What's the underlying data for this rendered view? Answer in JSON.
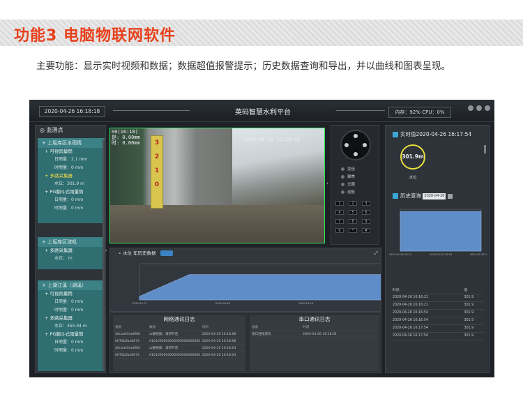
{
  "banner": {
    "title": "功能3  电脑物联网软件"
  },
  "description": "主要功能：显示实时视频和数据；数据超值报警提示；历史数据查询和导出，并以曲线和图表呈现。",
  "app": {
    "header": {
      "datetime": "2020-04-26 16:18:18",
      "title": "英码智慧水利平台",
      "status": "内存：92%  CPU：0%"
    },
    "sidebar": {
      "title": "监测点",
      "groups": [
        {
          "name": "上坂库区水雨情",
          "items": [
            {
              "label": "可视雨量筒",
              "values": [
                "日雨量：2.1 mm",
                "时雨量：0 mm"
              ]
            },
            {
              "label": "多路采集器",
              "selected": true,
              "values": [
                "水位：301.9 m"
              ]
            },
            {
              "label": "PG翻斗式雨量筒",
              "values": [
                "日雨量：0 mm",
                "时雨量：0 mm"
              ]
            }
          ]
        },
        {
          "name": "上坂库区球机",
          "items": [
            {
              "label": "多路采集器",
              "values": [
                "水位：  m"
              ]
            }
          ]
        },
        {
          "name": "上湖江溪（湖溪）",
          "items": [
            {
              "label": "可视雨量筒",
              "values": [
                "日雨量：0 mm",
                "时雨量：0 mm"
              ]
            },
            {
              "label": "多路采集器",
              "values": [
                "水位：355.04  m"
              ]
            },
            {
              "label": "PG翻斗式雨量筒",
              "values": [
                "日雨量：0 mm",
                "时雨量：0 mm"
              ]
            }
          ]
        }
      ]
    },
    "video": {
      "osd_left": "00(16:18)\n是: 0.00mm\n时: 0.00mm",
      "osd_right": "2020-04-26 16:18:18",
      "ruler": [
        "3",
        "2",
        "1",
        "0"
      ]
    },
    "ptz": {
      "buttons": [
        "变倍",
        "聚焦",
        "光圈",
        "巡航"
      ],
      "keys": [
        "1",
        "2",
        "3",
        "4",
        "5",
        "6",
        "7",
        "8",
        "9",
        "0",
        "*",
        "#"
      ]
    },
    "history_chart": {
      "title": "水位 年历史数据"
    },
    "logs": {
      "network": {
        "title": "网络通讯日志",
        "headers": [
          "设备",
          "数据",
          "时间"
        ],
        "rows": [
          [
            "d0cade5ea6f00",
            "山巅视频，请求开启",
            "2020-04-26 16:18:08"
          ],
          [
            "0070b5ba0874",
            "01010000000000000000000000000000",
            "2020-04-26 16:18:08"
          ],
          [
            "d0cade5ea6f00",
            "山巅视频，请求开启",
            "2020-04-26 16:18:03"
          ],
          [
            "0070b5ba0874",
            "01010000000000000000000000000000",
            "2020-04-26 16:18:03"
          ]
        ]
      },
      "serial": {
        "title": "串口通讯日志",
        "headers": [
          "设备",
          "",
          "时间"
        ],
        "rows": [
          [
            "接口连接成功",
            "",
            "2020-04-26 16:18:01"
          ]
        ]
      }
    },
    "right_panel": {
      "realtime_title": "实时值2020-04-26 16:17:54",
      "gauge_value": "301.9m",
      "gauge_label": "水位",
      "history_title": "历史查询",
      "history_date": "2020-04-26",
      "table_headers": [
        "时间",
        "值"
      ],
      "table_rows": [
        [
          "2020-04-26 16:16:21",
          "301.9"
        ],
        [
          "2020-04-26 16:16:21",
          "301.9"
        ],
        [
          "2020-04-26 16:16:54",
          "301.9"
        ],
        [
          "2020-04-26 16:16:54",
          "301.9"
        ],
        [
          "2020-04-26 16:17:54",
          "301.9"
        ],
        [
          "2020-04-26 16:17:54",
          "301.9"
        ]
      ]
    }
  },
  "chart_data": [
    {
      "type": "area",
      "ylim": [
        0,
        1
      ],
      "x": [
        "2020-03-27",
        "2020-04-06",
        "2020-04-16",
        "2020-04-26"
      ],
      "series": [
        {
          "values": [
            0.1,
            0.7,
            0.7,
            0.7,
            0.7,
            0.7
          ]
        }
      ]
    },
    {
      "type": "area",
      "ylim": [
        300.0,
        302.0
      ],
      "x": [
        "2020-04-26 16:15",
        "2020-04-26 16:16",
        "2020-04-26 16:17"
      ],
      "series": [
        {
          "values": [
            301.9,
            301.9,
            301.9
          ]
        }
      ]
    }
  ],
  "colors": {
    "accent": "#e8401c",
    "panel": "#2d3338",
    "teal": "#2f6e71",
    "chart_fill": "#5f8dc8",
    "gauge": "#e9df3e",
    "video_border": "#2ee85a"
  }
}
